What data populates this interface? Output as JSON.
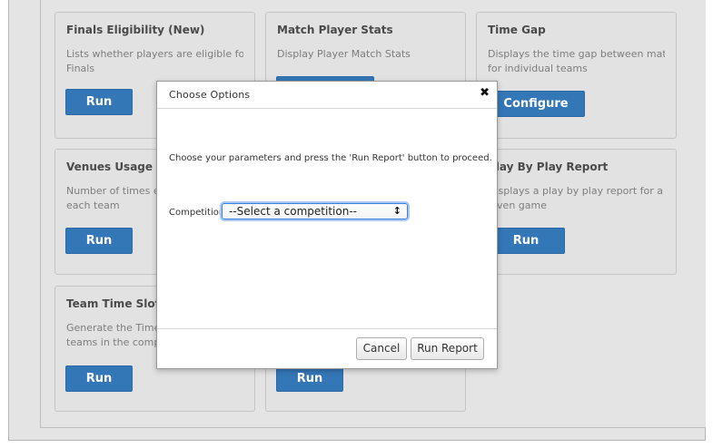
{
  "cards": [
    {
      "title": "Finals Eligibility (New)",
      "desc": [
        "Lists whether players are eligible for",
        "Finals"
      ],
      "button": "Run"
    },
    {
      "title": "Match Player Stats",
      "desc": [
        "Display Player Match Stats"
      ],
      "button": ""
    },
    {
      "title": "Time Gap",
      "desc": [
        "Displays the time gap between matches",
        "for individual teams"
      ],
      "button": "Configure"
    },
    {
      "title": "Venues Usage By Team",
      "desc": [
        "Number of times each venue is used by",
        "each team"
      ],
      "button": "Run"
    },
    {
      "title": "Play By Play Report",
      "desc": [
        "Displays a play by play report for a",
        "given game"
      ],
      "button": "Run"
    },
    {
      "title": "Team Time Slot Summary",
      "desc": [
        "Generate the Time Slot summary for",
        "teams in the competition"
      ],
      "button": "Run"
    },
    {
      "title": "",
      "desc": [],
      "button": "Run"
    }
  ],
  "modal": {
    "title": "Choose Options",
    "close_glyph": "✖",
    "instructions": "Choose your parameters and press the 'Run Report' button to proceed.",
    "competition_label": "Competition",
    "competition_value": "--Select a competition--",
    "cancel_label": "Cancel",
    "run_label": "Run Report"
  }
}
